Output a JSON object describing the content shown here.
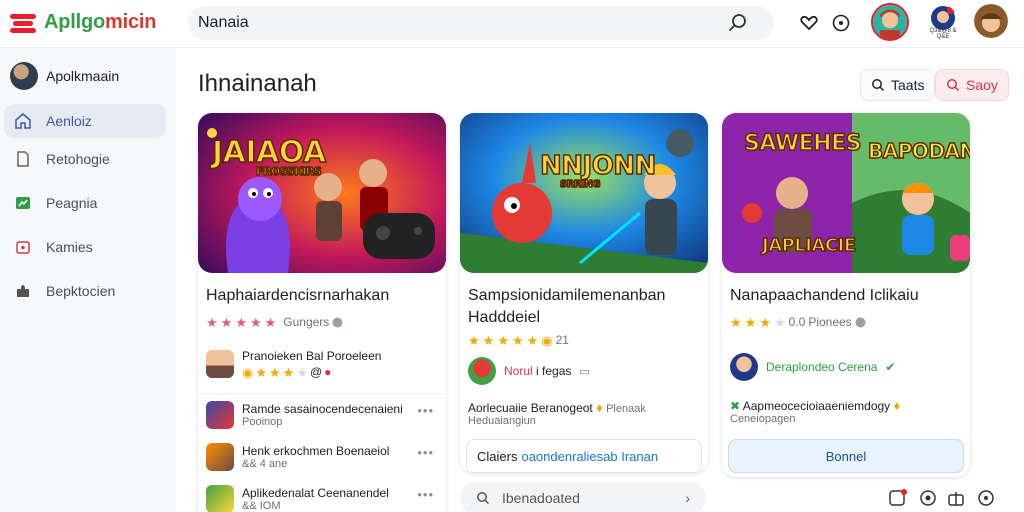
{
  "app": {
    "name_part1": "Apl",
    "name_part2": "lgo",
    "name_part3": "micin"
  },
  "search": {
    "value": "Nanaia"
  },
  "topbar": {
    "mini_label": "Q3&@8 & Q&E"
  },
  "sidebar": {
    "user": "Apolkmaain",
    "items": [
      {
        "label": "Aenloiz",
        "icon": "home-icon",
        "active": true
      },
      {
        "label": "Retohogie",
        "icon": "document-icon",
        "active": false
      },
      {
        "label": "Peagnia",
        "icon": "chart-icon",
        "active": false
      },
      {
        "label": "Kamies",
        "icon": "gamepad-icon",
        "active": false
      },
      {
        "label": "Bepktocien",
        "icon": "puzzle-icon",
        "active": false
      }
    ]
  },
  "main": {
    "title": "Ihnainanah",
    "actions": {
      "sort": "Taats",
      "filter": "Saoy"
    }
  },
  "cards": [
    {
      "banner_title": "JAIAOA",
      "banner_sub": "FROSSKIRS",
      "title": "Haphaiardencisrnarhakan",
      "rating_text": "Gungers",
      "featured": {
        "title": "Pranoieken Bal Poroeleen",
        "rating": "@"
      },
      "list": [
        {
          "title": "Ramde sasainocendecenaieni",
          "sub": "Pooinop"
        },
        {
          "title": "Henk erkochmen Boenaeiol",
          "sub": "&& 4 ane"
        },
        {
          "title": "Aplikedenalat Ceenanendel",
          "sub": "&& IOM"
        }
      ]
    },
    {
      "banner_title": "NNJONN",
      "banner_sub": "SRRING",
      "title": "Sampsionidamilemenanban Hadddeiel",
      "rating_text": "21",
      "featured": {
        "title_red": "Norul",
        "title_rest": "i fegas"
      },
      "info": {
        "title": "Aorlecuaiie Beranogeot",
        "extra": "Plenaak",
        "sub": "Heduaiangiun"
      },
      "claim": {
        "label": "Claiers",
        "link": "oaondenraliesab Iranan"
      },
      "bottom_search": "Ibenadoated"
    },
    {
      "banner_title": "SAWEHES",
      "banner_title2": "BAPODAN",
      "banner_sub": "JAPLIACIE",
      "title": "Nanapaachandend Iclikaiu",
      "rating_text": "Pionees",
      "rating_num": "0.0",
      "featured": {
        "title": "Deraplondeo Cerena"
      },
      "info": {
        "title": "Aapmeocecioiaaeniemdogy",
        "sub": "Ceneiopagen"
      },
      "button": "Bonnel"
    }
  ],
  "colors": {
    "accent_red": "#e8202e",
    "green": "#2f9e44",
    "blue": "#1a73e8"
  }
}
